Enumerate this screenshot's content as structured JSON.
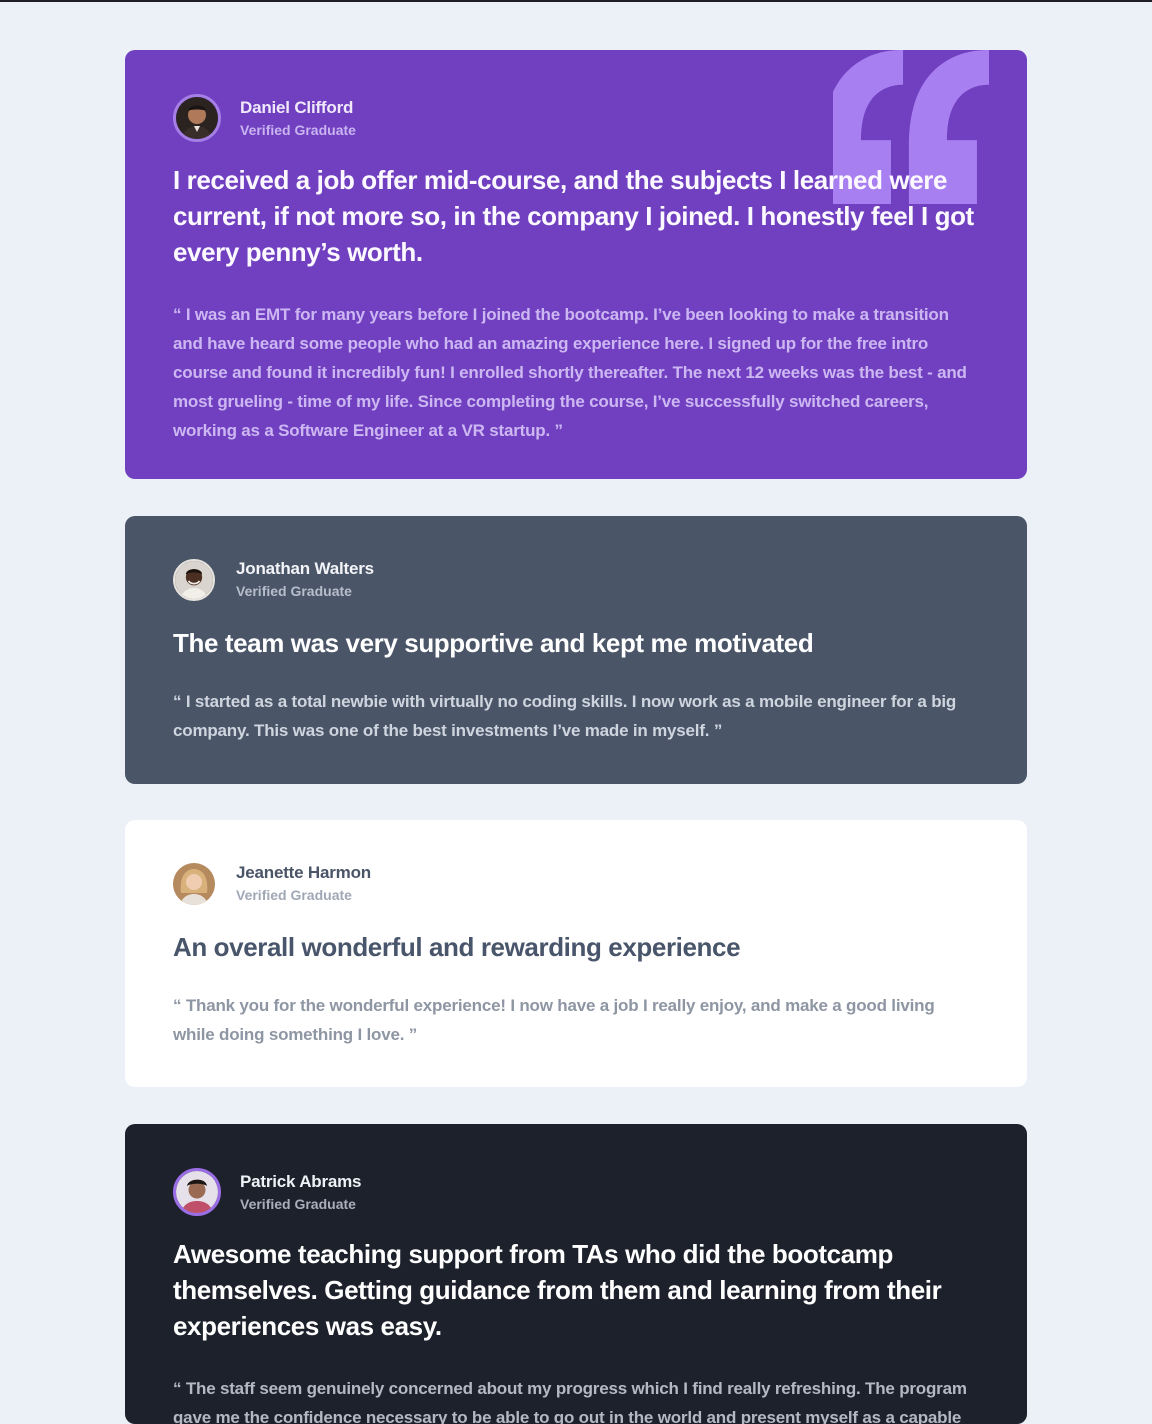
{
  "colors": {
    "page_background": "#ECF1F7",
    "card_purple": "#7040C0",
    "card_slate": "#4A5568",
    "card_white": "#FFFFFF",
    "card_dark": "#1D212B",
    "quote_accent": "#A77FF0"
  },
  "testimonials": [
    {
      "name": "Daniel Clifford",
      "role": "Verified Graduate",
      "headline": "I received a job offer mid-course, and the subjects I learned were current, if not more so, in the company I joined. I honestly feel I got every penny’s worth.",
      "quote": "“ I was an EMT for many years before I joined the bootcamp. I’ve been looking to make a transition and have heard some people who had an amazing experience here. I signed up for the free intro course and found it incredibly fun! I enrolled shortly thereafter. The next 12 weeks was the best - and most grueling - time of my life. Since completing the course, I’ve successfully switched careers, working as a Software Engineer at a VR startup. ”",
      "theme": "purple",
      "decoration_icon": "quotation-mark-icon"
    },
    {
      "name": "Jonathan Walters",
      "role": "Verified Graduate",
      "headline": "The team was very supportive and kept me motivated",
      "quote": "“ I started as a total newbie with virtually no coding skills. I now work as a mobile engineer for a big company. This was one of the best investments I’ve made in myself. ”",
      "theme": "slate"
    },
    {
      "name": "Jeanette Harmon",
      "role": "Verified Graduate",
      "headline": "An overall wonderful and rewarding experience",
      "quote": "“ Thank you for the wonderful experience! I now have a job I really enjoy, and make a good living while doing something I love. ”",
      "theme": "white"
    },
    {
      "name": "Patrick Abrams",
      "role": "Verified Graduate",
      "headline": "Awesome teaching support from TAs who did the bootcamp themselves. Getting guidance from them and learning from their experiences was easy.",
      "quote": "“ The staff seem genuinely concerned about my progress which I find really refreshing. The program gave me the confidence necessary to be able to go out in the world and present myself as a capable junior developer. The standard is definitely high, but the success of the bootcamp is worth the effort. ”",
      "theme": "dark"
    }
  ]
}
